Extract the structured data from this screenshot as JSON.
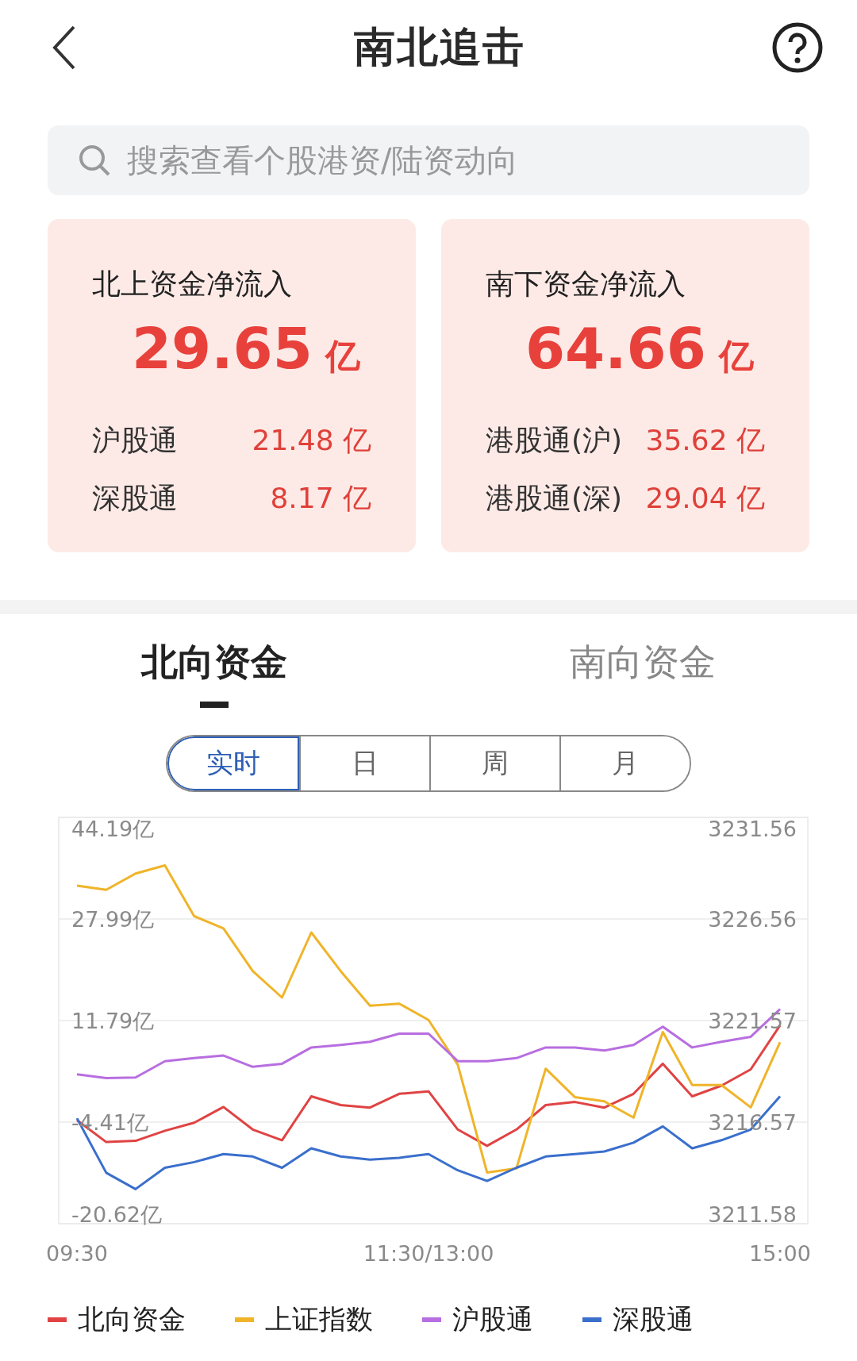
{
  "header": {
    "title": "南北追击"
  },
  "search": {
    "placeholder": "搜索查看个股港资/陆资动向"
  },
  "summary_cards": [
    {
      "title": "北上资金净流入",
      "amount": "29.65",
      "unit": "亿",
      "rows": [
        {
          "label": "沪股通",
          "value": "21.48 亿"
        },
        {
          "label": "深股通",
          "value": "8.17 亿"
        }
      ]
    },
    {
      "title": "南下资金净流入",
      "amount": "64.66",
      "unit": "亿",
      "rows": [
        {
          "label": "港股通(沪)",
          "value": "35.62 亿"
        },
        {
          "label": "港股通(深)",
          "value": "29.04 亿"
        }
      ]
    }
  ],
  "tabs": [
    {
      "label": "北向资金",
      "selected": true
    },
    {
      "label": "南向资金",
      "selected": false
    }
  ],
  "periods": [
    {
      "label": "实时",
      "selected": true
    },
    {
      "label": "日",
      "selected": false
    },
    {
      "label": "周",
      "selected": false
    },
    {
      "label": "月",
      "selected": false
    }
  ],
  "chart_data": {
    "type": "line",
    "categories": [
      "09:30",
      null,
      null,
      null,
      null,
      null,
      null,
      null,
      null,
      null,
      null,
      null,
      "11:30/13:00",
      null,
      null,
      null,
      null,
      null,
      null,
      null,
      null,
      null,
      null,
      null,
      "15:00"
    ],
    "grid": true,
    "ylim": [
      -20.62,
      44.19
    ],
    "yticks": [
      {
        "value": 44.19,
        "label": "44.19亿"
      },
      {
        "value": 27.99,
        "label": "27.99亿"
      },
      {
        "value": 11.79,
        "label": "11.79亿"
      },
      {
        "value": -4.41,
        "label": "-4.41亿"
      },
      {
        "value": -20.62,
        "label": "-20.62亿"
      }
    ],
    "y2lim": [
      3211.58,
      3231.56
    ],
    "y2ticks": [
      {
        "value": 3231.56,
        "label": "3231.56"
      },
      {
        "value": 3226.56,
        "label": "3226.56"
      },
      {
        "value": 3221.57,
        "label": "3221.57"
      },
      {
        "value": 3216.57,
        "label": "3216.57"
      },
      {
        "value": 3211.58,
        "label": "3211.58"
      }
    ],
    "series": [
      {
        "name": "北向资金",
        "color": "#e04343",
        "values": [
          -4.1,
          -7.6,
          -7.4,
          -5.8,
          -4.5,
          -2.0,
          -5.6,
          -7.3,
          -0.3,
          -1.7,
          -2.1,
          0.1,
          0.5,
          -5.6,
          -8.2,
          -5.6,
          -1.7,
          -1.2,
          -2.1,
          0.1,
          4.9,
          -0.3,
          1.4,
          4.0,
          11.0
        ]
      },
      {
        "name": "上证指数",
        "color": "#f0b429",
        "axis": "y2",
        "values": [
          3228.2,
          3228.0,
          3228.8,
          3229.2,
          3226.7,
          3226.1,
          3224.0,
          3222.7,
          3225.9,
          3224.0,
          3222.3,
          3222.4,
          3221.6,
          3219.4,
          3214.1,
          3214.3,
          3219.2,
          3217.8,
          3217.6,
          3216.8,
          3221.0,
          3218.4,
          3218.4,
          3217.3,
          3220.5
        ]
      },
      {
        "name": "沪股通",
        "color": "#b86ee0",
        "values": [
          3.2,
          2.6,
          2.7,
          5.3,
          5.8,
          6.2,
          4.4,
          4.9,
          7.5,
          7.9,
          8.4,
          9.7,
          9.7,
          5.3,
          5.3,
          5.8,
          7.5,
          7.5,
          7.0,
          7.9,
          10.8,
          7.5,
          8.4,
          9.2,
          13.6
        ]
      },
      {
        "name": "深股通",
        "color": "#3a6fcc",
        "values": [
          -3.8,
          -12.5,
          -15.1,
          -11.7,
          -10.8,
          -9.5,
          -9.9,
          -11.7,
          -8.6,
          -9.9,
          -10.4,
          -10.1,
          -9.5,
          -12.1,
          -13.8,
          -11.7,
          -9.9,
          -9.5,
          -9.1,
          -7.7,
          -5.1,
          -8.6,
          -7.3,
          -5.6,
          -0.3
        ]
      }
    ]
  }
}
